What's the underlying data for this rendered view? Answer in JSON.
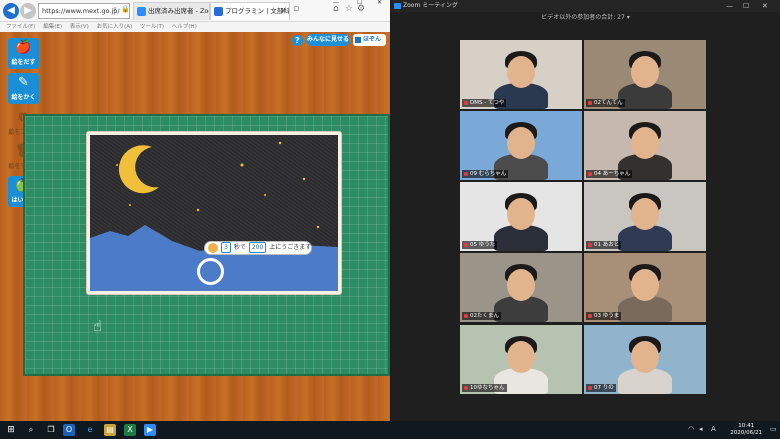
{
  "browser": {
    "url": "https://www.mext.go.jp/",
    "tabs": [
      {
        "label": "出席済み出席者 - Zoom",
        "color": "#2d8cff"
      },
      {
        "label": "プログラミン | 文部科学省",
        "color": "#2a6bd6"
      }
    ],
    "menu": [
      "ファイル(F)",
      "編集(E)",
      "表示(V)",
      "お気に入り(A)",
      "ツール(T)",
      "ヘルプ(H)"
    ],
    "window_controls": [
      "—",
      "☐",
      "✕"
    ]
  },
  "app": {
    "help_label": "?",
    "show_label": "みんなに見せる",
    "save_label": "ほぞん",
    "side_buttons": [
      {
        "label": "絵をだす",
        "icon": "apple-icon",
        "glyph": "🍎",
        "enabled": true
      },
      {
        "label": "絵をかく",
        "icon": "pencil-icon",
        "glyph": "✎",
        "enabled": true
      },
      {
        "label": "絵をコピー",
        "icon": "copy-icon",
        "glyph": "⧉",
        "enabled": false
      },
      {
        "label": "絵をすてる",
        "icon": "trash-icon",
        "glyph": "🗑",
        "enabled": false
      },
      {
        "label": "はいけい",
        "icon": "background-icon",
        "glyph": "🍏",
        "enabled": true
      }
    ],
    "code_block": {
      "value1": "3",
      "text1": "秒で",
      "value2": "200",
      "text2": "上にうごきます"
    },
    "palette_icons": [
      "⇐",
      "⇒",
      "⇑",
      "⇓",
      "⋀",
      "⋈",
      "↺",
      "↻",
      "∿",
      "⌘",
      "⋉",
      "✂",
      "⊞",
      "⊟",
      "✱",
      "◉",
      "❀",
      "♪",
      "❖",
      "✎",
      "∞",
      "⚑",
      "⊕",
      "✚",
      "◀",
      "▶",
      "✦",
      "⊛",
      "◍"
    ]
  },
  "zoom": {
    "window_title": "Zoom ミーティング",
    "gallery_title": "ビデオ以外の参加者の合計: 27 ▾",
    "participants": [
      {
        "name": "DMS - てつや",
        "bg": "#d7d0c6",
        "shirt": "#2b3950",
        "speaking": false
      },
      {
        "name": "02てんてん",
        "bg": "#9a8a75",
        "shirt": "#3b3b3b",
        "speaking": false
      },
      {
        "name": "09 むらちゃん",
        "bg": "#7aa9d8",
        "shirt": "#4b4b4b",
        "speaking": false
      },
      {
        "name": "04 あーちゃん",
        "bg": "#c5b8ae",
        "shirt": "#34302d",
        "speaking": true
      },
      {
        "name": "05 ゆうた",
        "bg": "#e5e5e5",
        "shirt": "#2b2f3a",
        "speaking": false
      },
      {
        "name": "01 あおと",
        "bg": "#c9c6c2",
        "shirt": "#2f3b55",
        "speaking": false
      },
      {
        "name": "02たくまん",
        "bg": "#9a9489",
        "shirt": "#3d3d3d",
        "speaking": false
      },
      {
        "name": "03 ゆうま",
        "bg": "#a88f78",
        "shirt": "#7a6a5b",
        "speaking": false
      },
      {
        "name": "10ゆなちゃん",
        "bg": "#b6c3b0",
        "shirt": "#e8e6e0",
        "speaking": false
      },
      {
        "name": "07 りの",
        "bg": "#8fb4cc",
        "shirt": "#d9d3cd",
        "speaking": false
      }
    ]
  },
  "taskbar": {
    "time": "10:41",
    "date": "2020/06/21",
    "ime": "A"
  }
}
